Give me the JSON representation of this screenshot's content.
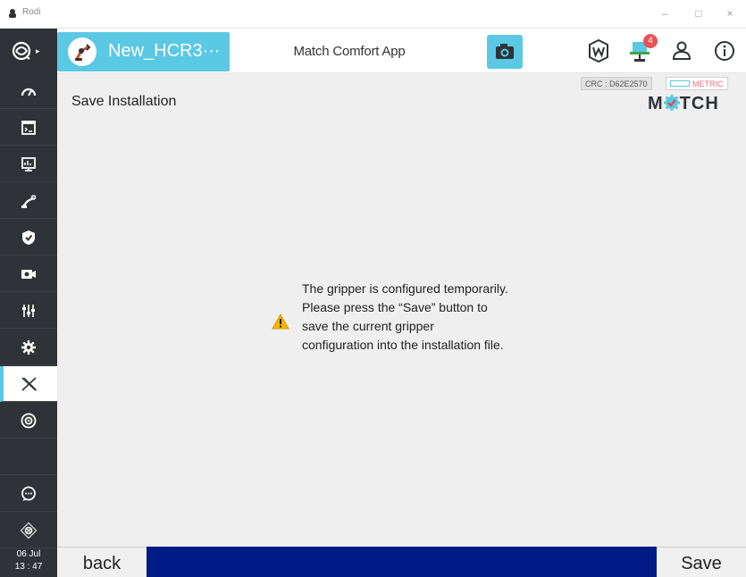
{
  "window": {
    "title": "Rodi",
    "minimize_glyph": "–",
    "maximize_glyph": "□",
    "close_glyph": "×"
  },
  "header": {
    "program_name": "New_HCR3···",
    "app_title": "Match Comfort App",
    "notification_count": "4",
    "icons": [
      "camera-icon",
      "w-badge-icon",
      "network-icon",
      "user-icon",
      "info-icon"
    ]
  },
  "sidebar": {
    "items": [
      "dashboard-icon",
      "program-icon",
      "monitor-icon",
      "robot-arm-icon",
      "safety-shield-icon",
      "camera-settings-icon",
      "io-sliders-icon",
      "settings-gear-icon",
      "x-app-icon",
      "target-icon",
      "blank",
      "chat-icon",
      "jog-icon"
    ],
    "date": "06 Jul",
    "time": "13 : 47"
  },
  "main": {
    "page_title": "Save Installation",
    "crc": "CRC : D62E2570",
    "unit": "METRIC",
    "brand_left": "M",
    "brand_right": "TCH",
    "warning_lines": [
      "The gripper is configured temporarily.",
      "Please press the “Save” button to",
      "save the current gripper",
      "configuration into the installation file."
    ]
  },
  "footer": {
    "back_label": "back",
    "save_label": "Save"
  },
  "colors": {
    "accent": "#5bc8e4",
    "sidebar": "#2f3337",
    "bottom_bar": "#001a86",
    "warning": "#f5b400",
    "badge": "#e85454"
  }
}
